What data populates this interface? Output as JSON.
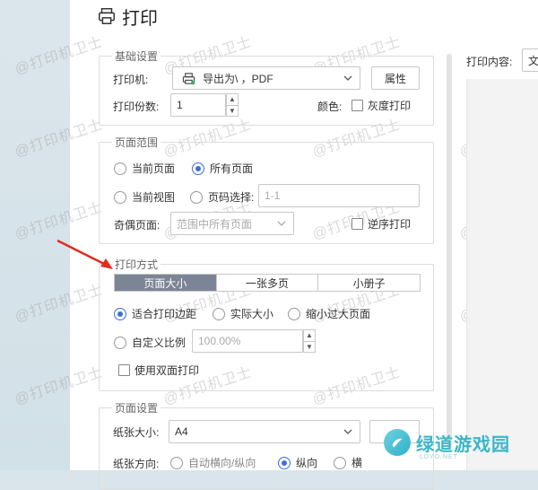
{
  "title": "打印",
  "basic": {
    "legend": "基础设置",
    "printer_label": "打印机:",
    "printer_value": "导出为\\ ，PDF",
    "properties_button": "属性",
    "copies_label": "打印份数:",
    "copies_value": "1",
    "color_label": "颜色:",
    "grayscale_label": "灰度打印"
  },
  "page_range": {
    "legend": "页面范围",
    "current_page": "当前页面",
    "all_pages": "所有页面",
    "current_view": "当前视图",
    "page_select": "页码选择:",
    "page_select_placeholder": "1-1",
    "odd_even_label": "奇偶页面:",
    "odd_even_value": "范围中所有页面",
    "reverse_label": "逆序打印"
  },
  "print_mode": {
    "legend": "打印方式",
    "tabs": [
      "页面大小",
      "一张多页",
      "小册子"
    ],
    "fit_margin": "适合打印边距",
    "actual_size": "实际大小",
    "shrink_large": "缩小过大页面",
    "custom_scale": "自定义比例",
    "scale_value": "100.00%",
    "duplex_label": "使用双面打印"
  },
  "page_setup": {
    "legend": "页面设置",
    "paper_size_label": "纸张大小:",
    "paper_size_value": "A4",
    "orientation_label": "纸张方向:",
    "auto_orient": "自动横向/纵向",
    "portrait": "纵向",
    "landscape": "横"
  },
  "preview": {
    "content_label": "打印内容:",
    "content_value": "文"
  },
  "watermark_text": "@打印机卫士",
  "logo": {
    "name": "绿道游戏园",
    "sub": "LDYO.NET"
  },
  "colors": {
    "accent": "#3b6fd6",
    "active_tab": "#7b8595",
    "annotation_arrow": "#e02d20"
  }
}
